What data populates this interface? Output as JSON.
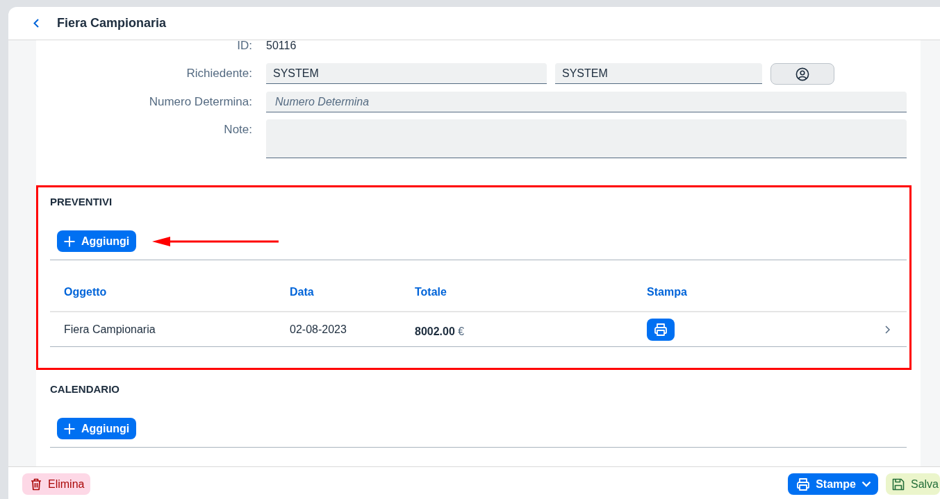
{
  "header": {
    "title": "Fiera Campionaria"
  },
  "form": {
    "fields": [
      {
        "kind": "text",
        "label": "ID:",
        "value": "50116"
      },
      {
        "kind": "lookup",
        "label": "Richiedente:",
        "values": [
          "SYSTEM",
          "SYSTEM"
        ]
      },
      {
        "kind": "input",
        "label": "Numero Determina:",
        "placeholder": "Numero Determina"
      },
      {
        "kind": "textarea",
        "label": "Note:"
      }
    ]
  },
  "sections": [
    {
      "title": "PREVENTIVI",
      "highlighted": true,
      "add_button": "Aggiungi",
      "table": {
        "columns": [
          "Oggetto",
          "Data",
          "Totale",
          "Stampa"
        ],
        "rows": [
          {
            "cells": [
              "Fiera Campionaria",
              "02-08-2023",
              "**8002.00** €"
            ]
          }
        ]
      }
    },
    {
      "title": "CALENDARIO",
      "highlighted": false,
      "add_button": "Aggiungi"
    }
  ],
  "footer": {
    "buttons": [
      {
        "kind": "delete",
        "label": "Elimina"
      },
      {
        "kind": "print",
        "label": "Stampe"
      },
      {
        "kind": "save",
        "label": "Salva"
      }
    ]
  }
}
